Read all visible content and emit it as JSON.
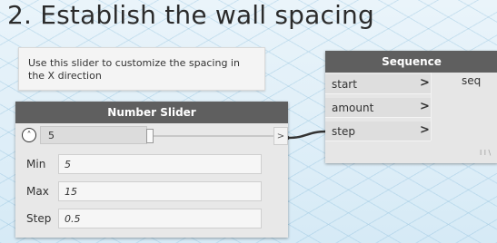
{
  "title": "2. Establish the wall spacing",
  "note": {
    "text": "Use this slider to customize the spacing in the X direction"
  },
  "slider": {
    "header": "Number Slider",
    "collapse_glyph": "˄",
    "value": "5",
    "out_glyph": ">",
    "fields": [
      {
        "label": "Min",
        "value": "5"
      },
      {
        "label": "Max",
        "value": "15"
      },
      {
        "label": "Step",
        "value": "0.5"
      }
    ]
  },
  "sequence": {
    "header": "Sequence",
    "inputs": [
      {
        "label": "start",
        "arrow": ">"
      },
      {
        "label": "amount",
        "arrow": ">"
      },
      {
        "label": "step",
        "arrow": ">"
      }
    ],
    "output": "seq",
    "lacing": "l l \\"
  }
}
